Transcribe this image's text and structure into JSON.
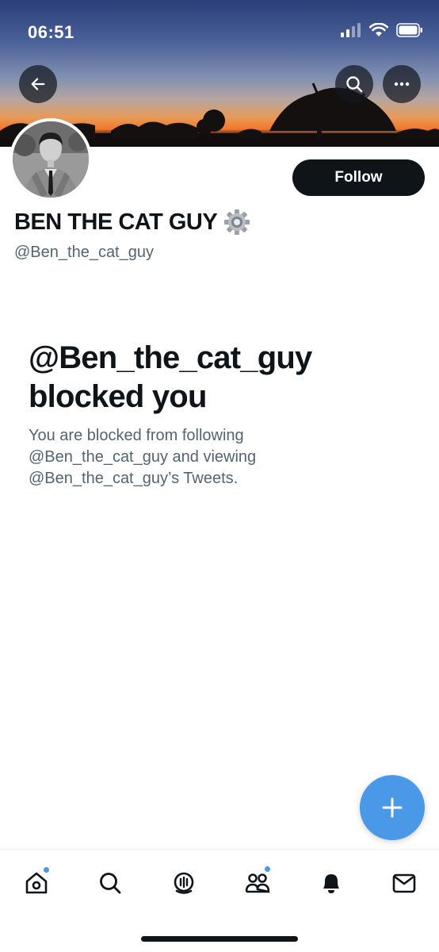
{
  "status_bar": {
    "time": "06:51"
  },
  "header": {
    "back_icon": "arrow-left-icon",
    "search_icon": "search-icon",
    "more_icon": "more-horizontal-icon"
  },
  "profile": {
    "display_name": "BEN THE CAT GUY",
    "badge_emoji": "⚙️",
    "handle": "@Ben_the_cat_guy",
    "follow_label": "Follow"
  },
  "blocked": {
    "title_line1": "@Ben_the_cat_guy",
    "title_line2": "blocked you",
    "desc_line1": "You are blocked from following",
    "desc_line2": "@Ben_the_cat_guy and viewing",
    "desc_line3": "@Ben_the_cat_guy’s Tweets."
  },
  "tabbar": {
    "items": [
      {
        "icon": "home-icon",
        "has_dot": true
      },
      {
        "icon": "search-icon",
        "has_dot": false
      },
      {
        "icon": "spaces-icon",
        "has_dot": false
      },
      {
        "icon": "communities-icon",
        "has_dot": true
      },
      {
        "icon": "bell-icon",
        "has_dot": false
      },
      {
        "icon": "mail-icon",
        "has_dot": false
      }
    ]
  },
  "colors": {
    "accent": "#4a99e9",
    "text_primary": "#0f1419",
    "text_secondary": "#536471"
  }
}
